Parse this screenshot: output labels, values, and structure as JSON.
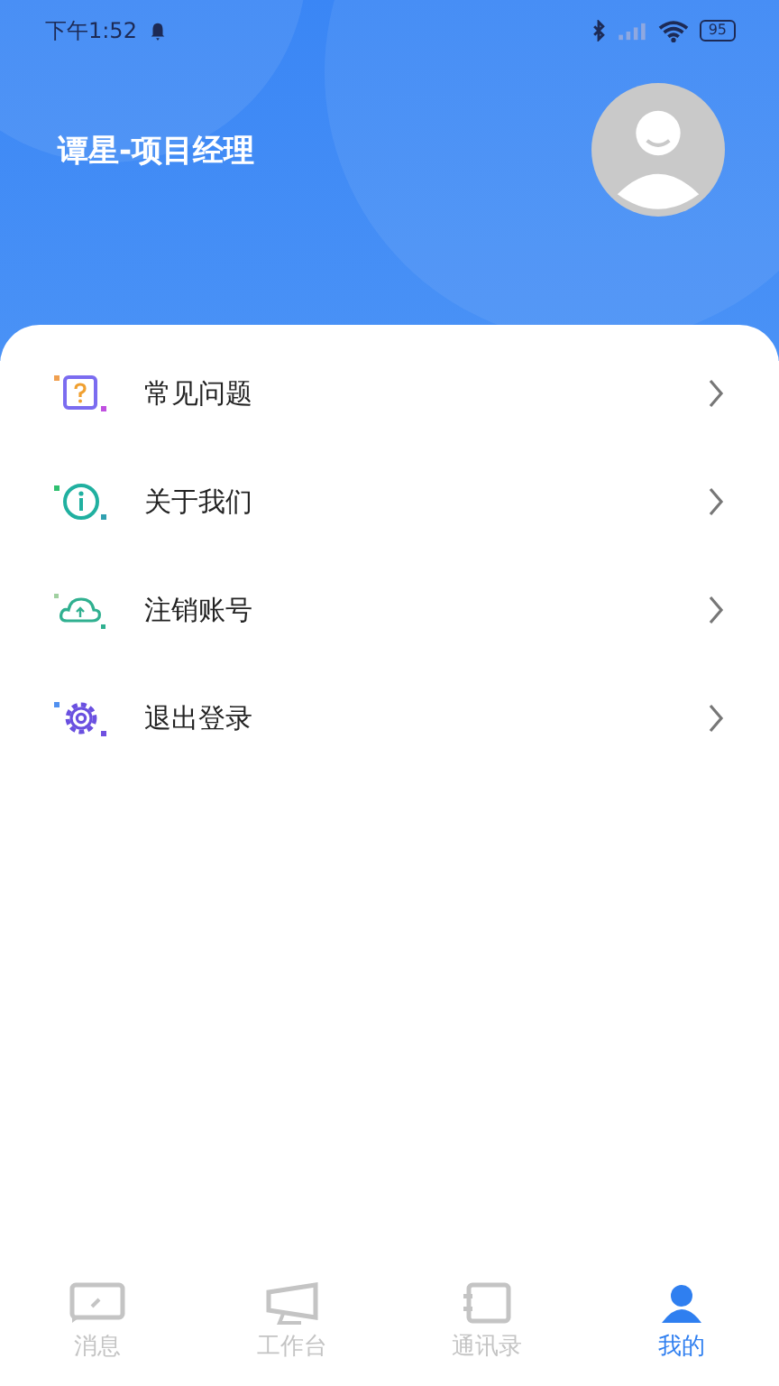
{
  "status_bar": {
    "time": "下午1:52",
    "battery": "95"
  },
  "profile": {
    "name": "谭星-项目经理"
  },
  "menu": [
    {
      "kind": "faq",
      "label": "常见问题"
    },
    {
      "kind": "about",
      "label": "关于我们"
    },
    {
      "kind": "cancel",
      "label": "注销账号"
    },
    {
      "kind": "logout",
      "label": "退出登录"
    }
  ],
  "tabs": [
    {
      "kind": "message",
      "label": "消息",
      "selected": false
    },
    {
      "kind": "workbench",
      "label": "工作台",
      "selected": false
    },
    {
      "kind": "contacts",
      "label": "通讯录",
      "selected": false
    },
    {
      "kind": "me",
      "label": "我的",
      "selected": true
    }
  ]
}
